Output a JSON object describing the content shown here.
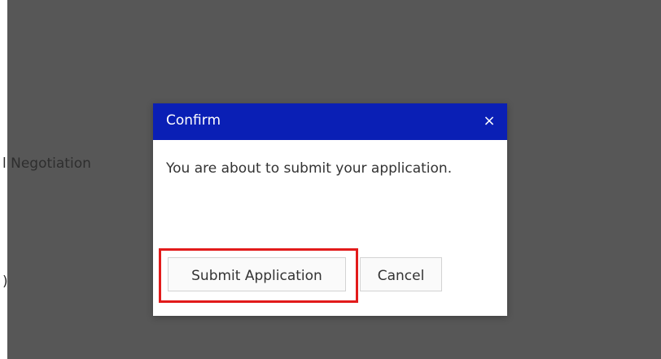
{
  "background": {
    "text_fragment_1": "l Negotiation",
    "text_fragment_2": ")"
  },
  "dialog": {
    "title": "Confirm",
    "close_label": "×",
    "message": "You are about to submit your application.",
    "buttons": {
      "submit_label": "Submit Application",
      "cancel_label": "Cancel"
    }
  },
  "colors": {
    "header": "#0a1fb5",
    "overlay": "#575757",
    "highlight": "#e21b1b",
    "button_bg": "#fafafa",
    "button_border": "#d3d3d3"
  }
}
